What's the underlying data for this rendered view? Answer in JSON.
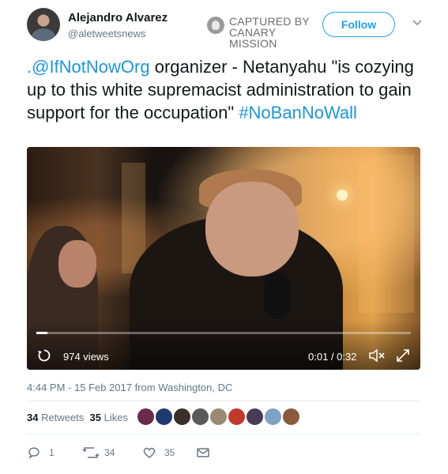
{
  "author": {
    "name": "Alejandro Alvarez",
    "handle": "@aletweetsnews"
  },
  "watermark": {
    "line1": "CAPTURED BY",
    "line2": "CANARY MISSION"
  },
  "follow_label": "Follow",
  "tweet": {
    "mention": ".@IfNotNowOrg",
    "text": " organizer - Netanyahu \"is cozying up to this white supremacist administration to gain support for the occupation\" ",
    "hashtag": "#NoBanNoWall"
  },
  "video": {
    "views": "974 views",
    "time": "0:01 / 0:32",
    "progress": 0.03
  },
  "timestamp": "4:44 PM - 15 Feb 2017 from Washington, DC",
  "stats": {
    "retweets_count": "34",
    "retweets_label": "Retweets",
    "likes_count": "35",
    "likes_label": "Likes"
  },
  "likers": [
    "#6a2a4a",
    "#1e3a6e",
    "#3a2f2a",
    "#5a5a5a",
    "#9a8a70",
    "#c0392b",
    "#4a3a5a",
    "#7fa3c6",
    "#8a5a3a"
  ],
  "actions": {
    "reply_count": "1",
    "retweet_count": "34",
    "like_count": "35"
  }
}
